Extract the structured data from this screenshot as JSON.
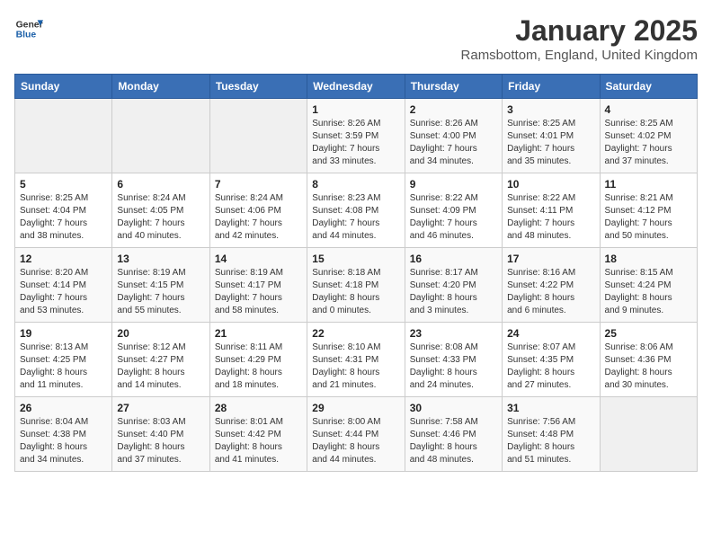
{
  "header": {
    "logo_line1": "General",
    "logo_line2": "Blue",
    "title": "January 2025",
    "subtitle": "Ramsbottom, England, United Kingdom"
  },
  "weekdays": [
    "Sunday",
    "Monday",
    "Tuesday",
    "Wednesday",
    "Thursday",
    "Friday",
    "Saturday"
  ],
  "weeks": [
    [
      {
        "day": "",
        "info": ""
      },
      {
        "day": "",
        "info": ""
      },
      {
        "day": "",
        "info": ""
      },
      {
        "day": "1",
        "info": "Sunrise: 8:26 AM\nSunset: 3:59 PM\nDaylight: 7 hours\nand 33 minutes."
      },
      {
        "day": "2",
        "info": "Sunrise: 8:26 AM\nSunset: 4:00 PM\nDaylight: 7 hours\nand 34 minutes."
      },
      {
        "day": "3",
        "info": "Sunrise: 8:25 AM\nSunset: 4:01 PM\nDaylight: 7 hours\nand 35 minutes."
      },
      {
        "day": "4",
        "info": "Sunrise: 8:25 AM\nSunset: 4:02 PM\nDaylight: 7 hours\nand 37 minutes."
      }
    ],
    [
      {
        "day": "5",
        "info": "Sunrise: 8:25 AM\nSunset: 4:04 PM\nDaylight: 7 hours\nand 38 minutes."
      },
      {
        "day": "6",
        "info": "Sunrise: 8:24 AM\nSunset: 4:05 PM\nDaylight: 7 hours\nand 40 minutes."
      },
      {
        "day": "7",
        "info": "Sunrise: 8:24 AM\nSunset: 4:06 PM\nDaylight: 7 hours\nand 42 minutes."
      },
      {
        "day": "8",
        "info": "Sunrise: 8:23 AM\nSunset: 4:08 PM\nDaylight: 7 hours\nand 44 minutes."
      },
      {
        "day": "9",
        "info": "Sunrise: 8:22 AM\nSunset: 4:09 PM\nDaylight: 7 hours\nand 46 minutes."
      },
      {
        "day": "10",
        "info": "Sunrise: 8:22 AM\nSunset: 4:11 PM\nDaylight: 7 hours\nand 48 minutes."
      },
      {
        "day": "11",
        "info": "Sunrise: 8:21 AM\nSunset: 4:12 PM\nDaylight: 7 hours\nand 50 minutes."
      }
    ],
    [
      {
        "day": "12",
        "info": "Sunrise: 8:20 AM\nSunset: 4:14 PM\nDaylight: 7 hours\nand 53 minutes."
      },
      {
        "day": "13",
        "info": "Sunrise: 8:19 AM\nSunset: 4:15 PM\nDaylight: 7 hours\nand 55 minutes."
      },
      {
        "day": "14",
        "info": "Sunrise: 8:19 AM\nSunset: 4:17 PM\nDaylight: 7 hours\nand 58 minutes."
      },
      {
        "day": "15",
        "info": "Sunrise: 8:18 AM\nSunset: 4:18 PM\nDaylight: 8 hours\nand 0 minutes."
      },
      {
        "day": "16",
        "info": "Sunrise: 8:17 AM\nSunset: 4:20 PM\nDaylight: 8 hours\nand 3 minutes."
      },
      {
        "day": "17",
        "info": "Sunrise: 8:16 AM\nSunset: 4:22 PM\nDaylight: 8 hours\nand 6 minutes."
      },
      {
        "day": "18",
        "info": "Sunrise: 8:15 AM\nSunset: 4:24 PM\nDaylight: 8 hours\nand 9 minutes."
      }
    ],
    [
      {
        "day": "19",
        "info": "Sunrise: 8:13 AM\nSunset: 4:25 PM\nDaylight: 8 hours\nand 11 minutes."
      },
      {
        "day": "20",
        "info": "Sunrise: 8:12 AM\nSunset: 4:27 PM\nDaylight: 8 hours\nand 14 minutes."
      },
      {
        "day": "21",
        "info": "Sunrise: 8:11 AM\nSunset: 4:29 PM\nDaylight: 8 hours\nand 18 minutes."
      },
      {
        "day": "22",
        "info": "Sunrise: 8:10 AM\nSunset: 4:31 PM\nDaylight: 8 hours\nand 21 minutes."
      },
      {
        "day": "23",
        "info": "Sunrise: 8:08 AM\nSunset: 4:33 PM\nDaylight: 8 hours\nand 24 minutes."
      },
      {
        "day": "24",
        "info": "Sunrise: 8:07 AM\nSunset: 4:35 PM\nDaylight: 8 hours\nand 27 minutes."
      },
      {
        "day": "25",
        "info": "Sunrise: 8:06 AM\nSunset: 4:36 PM\nDaylight: 8 hours\nand 30 minutes."
      }
    ],
    [
      {
        "day": "26",
        "info": "Sunrise: 8:04 AM\nSunset: 4:38 PM\nDaylight: 8 hours\nand 34 minutes."
      },
      {
        "day": "27",
        "info": "Sunrise: 8:03 AM\nSunset: 4:40 PM\nDaylight: 8 hours\nand 37 minutes."
      },
      {
        "day": "28",
        "info": "Sunrise: 8:01 AM\nSunset: 4:42 PM\nDaylight: 8 hours\nand 41 minutes."
      },
      {
        "day": "29",
        "info": "Sunrise: 8:00 AM\nSunset: 4:44 PM\nDaylight: 8 hours\nand 44 minutes."
      },
      {
        "day": "30",
        "info": "Sunrise: 7:58 AM\nSunset: 4:46 PM\nDaylight: 8 hours\nand 48 minutes."
      },
      {
        "day": "31",
        "info": "Sunrise: 7:56 AM\nSunset: 4:48 PM\nDaylight: 8 hours\nand 51 minutes."
      },
      {
        "day": "",
        "info": ""
      }
    ]
  ]
}
